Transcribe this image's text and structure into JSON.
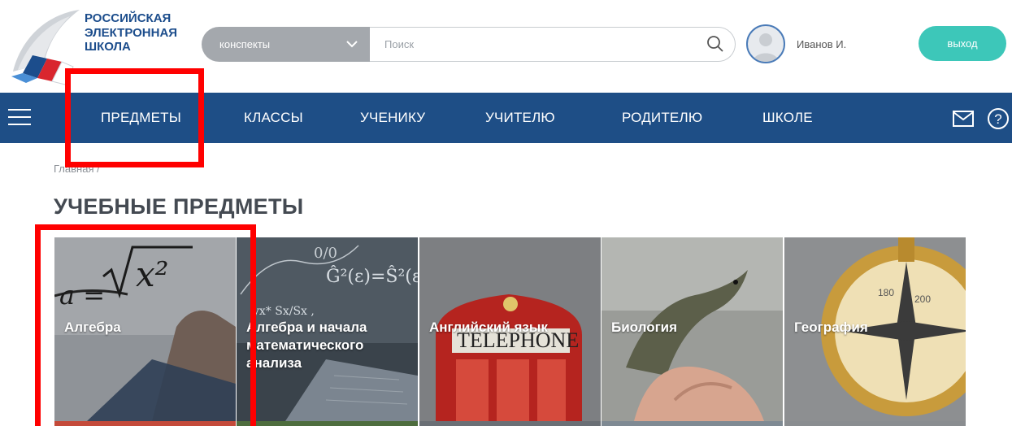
{
  "header": {
    "logo_lines": [
      "РОССИЙСКАЯ",
      "ЭЛЕКТРОННАЯ",
      "ШКОЛА"
    ],
    "search": {
      "category_value": "конспекты",
      "placeholder": "Поиск"
    },
    "user_name": "Иванов И.",
    "logout_label": "выход"
  },
  "nav": {
    "items": [
      "ПРЕДМЕТЫ",
      "КЛАССЫ",
      "УЧЕНИКУ",
      "УЧИТЕЛЮ",
      "РОДИТЕЛЮ",
      "ШКОЛЕ"
    ]
  },
  "breadcrumb": "Главная /",
  "page_title": "УЧЕБНЫЕ ПРЕДМЕТЫ",
  "subjects": [
    {
      "label": "Алгебра",
      "icon": "algebra-formula"
    },
    {
      "label": "Алгебра и начала математического анализа",
      "icon": "math-chalkboard"
    },
    {
      "label": "Английский язык",
      "icon": "telephone-booth"
    },
    {
      "label": "Биология",
      "icon": "lizard"
    },
    {
      "label": "География",
      "icon": "compass"
    }
  ],
  "colors": {
    "brand_blue": "#1e4e86",
    "accent_teal": "#3dc7b9",
    "highlight_red": "#ff0000"
  }
}
